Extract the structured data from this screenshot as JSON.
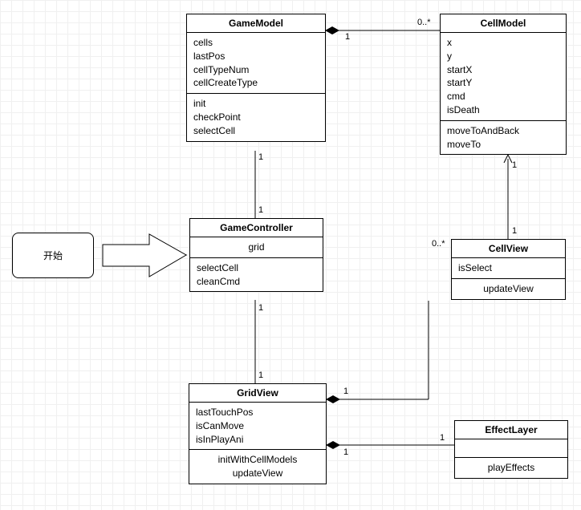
{
  "start": {
    "label": "开始"
  },
  "classes": {
    "GameModel": {
      "name": "GameModel",
      "attrs": [
        "cells",
        "lastPos",
        "cellTypeNum",
        "cellCreateType"
      ],
      "ops": [
        "init",
        "checkPoint",
        "selectCell"
      ]
    },
    "CellModel": {
      "name": "CellModel",
      "attrs": [
        "x",
        "y",
        "startX",
        "startY",
        "cmd",
        "isDeath"
      ],
      "ops": [
        "moveToAndBack",
        "moveTo"
      ]
    },
    "GameController": {
      "name": "GameController",
      "attrs": [
        "grid"
      ],
      "ops": [
        "selectCell",
        "cleanCmd"
      ]
    },
    "CellView": {
      "name": "CellView",
      "attrs": [
        "isSelect"
      ],
      "ops": [
        "updateView"
      ]
    },
    "GridView": {
      "name": "GridView",
      "attrs": [
        "lastTouchPos",
        "isCanMove",
        "isInPlayAni"
      ],
      "ops": [
        "initWithCellModels",
        "updateView"
      ]
    },
    "EffectLayer": {
      "name": "EffectLayer",
      "attrs": [],
      "ops": [
        "playEffects"
      ]
    }
  },
  "multiplicities": {
    "gm_cm_near": "1",
    "gm_cm_far": "0..*",
    "gm_gc_top": "1",
    "gm_gc_bot": "1",
    "gc_gv_top": "1",
    "gc_gv_bot": "1",
    "gv_cv_near": "1",
    "gv_cv_far": "0..*",
    "gv_el_near": "1",
    "gv_el_far": "1",
    "cv_cm_top": "1",
    "cv_cm_bot": "1"
  }
}
